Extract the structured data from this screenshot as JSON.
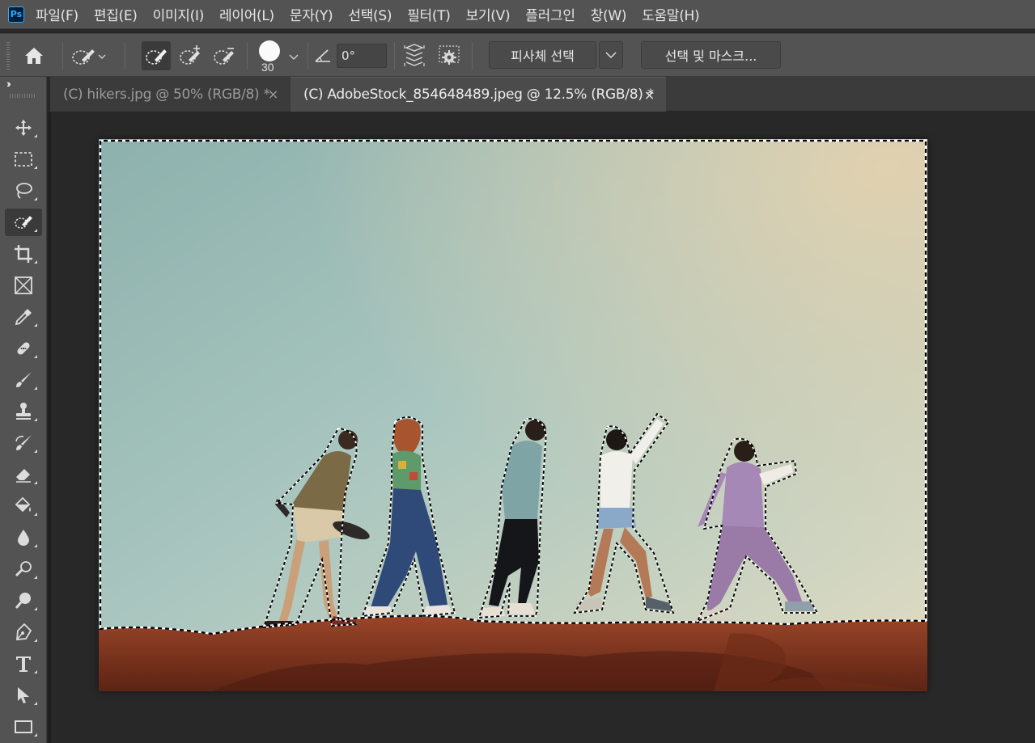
{
  "app": {
    "logo_text": "Ps"
  },
  "menu": [
    {
      "label": "파일(F)"
    },
    {
      "label": "편집(E)"
    },
    {
      "label": "이미지(I)"
    },
    {
      "label": "레이어(L)"
    },
    {
      "label": "문자(Y)"
    },
    {
      "label": "선택(S)"
    },
    {
      "label": "필터(T)"
    },
    {
      "label": "보기(V)"
    },
    {
      "label": "플러그인"
    },
    {
      "label": "창(W)"
    },
    {
      "label": "도움말(H)"
    }
  ],
  "options_bar": {
    "home_icon": "home-icon",
    "tool_preset_icon": "quick-selection-icon",
    "modes": [
      {
        "icon": "new-selection-icon",
        "active": true
      },
      {
        "icon": "add-to-selection-icon",
        "active": false
      },
      {
        "icon": "subtract-from-selection-icon",
        "active": false
      }
    ],
    "brush_size": "30",
    "angle_value": "0°",
    "sample_all_layers_icon": "sample-all-layers-icon",
    "enhance_edge_icon": "enhance-edge-gear-icon",
    "select_subject_label": "피사체 선택",
    "select_and_mask_label": "선택 및 마스크..."
  },
  "tool_panel": {
    "collapse_label": "››",
    "tools": [
      {
        "name": "move-tool-icon",
        "active": false
      },
      {
        "name": "rectangular-marquee-icon",
        "active": false
      },
      {
        "name": "lasso-icon",
        "active": false
      },
      {
        "name": "quick-selection-icon",
        "active": true
      },
      {
        "name": "crop-icon",
        "active": false
      },
      {
        "name": "frame-icon",
        "active": false
      },
      {
        "name": "eyedropper-icon",
        "active": false
      },
      {
        "name": "spot-healing-icon",
        "active": false
      },
      {
        "name": "brush-icon",
        "active": false
      },
      {
        "name": "clone-stamp-icon",
        "active": false
      },
      {
        "name": "history-brush-icon",
        "active": false
      },
      {
        "name": "eraser-icon",
        "active": false
      },
      {
        "name": "paint-bucket-icon",
        "active": false
      },
      {
        "name": "blur-icon",
        "active": false
      },
      {
        "name": "dodge-icon",
        "active": false
      },
      {
        "name": "zoom-icon",
        "active": false
      },
      {
        "name": "pen-icon",
        "active": false
      },
      {
        "name": "type-icon",
        "active": false
      },
      {
        "name": "path-selection-icon",
        "active": false
      },
      {
        "name": "rectangle-icon",
        "active": false
      }
    ]
  },
  "tabs": [
    {
      "label": "(C) hikers.jpg @ 50% (RGB/8) *",
      "active": false,
      "close": "×"
    },
    {
      "label": "(C) AdobeStock_854648489.jpeg @ 12.5% (RGB/8) *",
      "active": true,
      "close": "×"
    }
  ],
  "colors": {
    "ui_bg": "#535353",
    "workspace": "#282828",
    "sky_top": "#8fb3ad",
    "sky_warm": "#d9cdb0",
    "rock": "#8a3a22",
    "active_tool": "#3a3a3a"
  }
}
